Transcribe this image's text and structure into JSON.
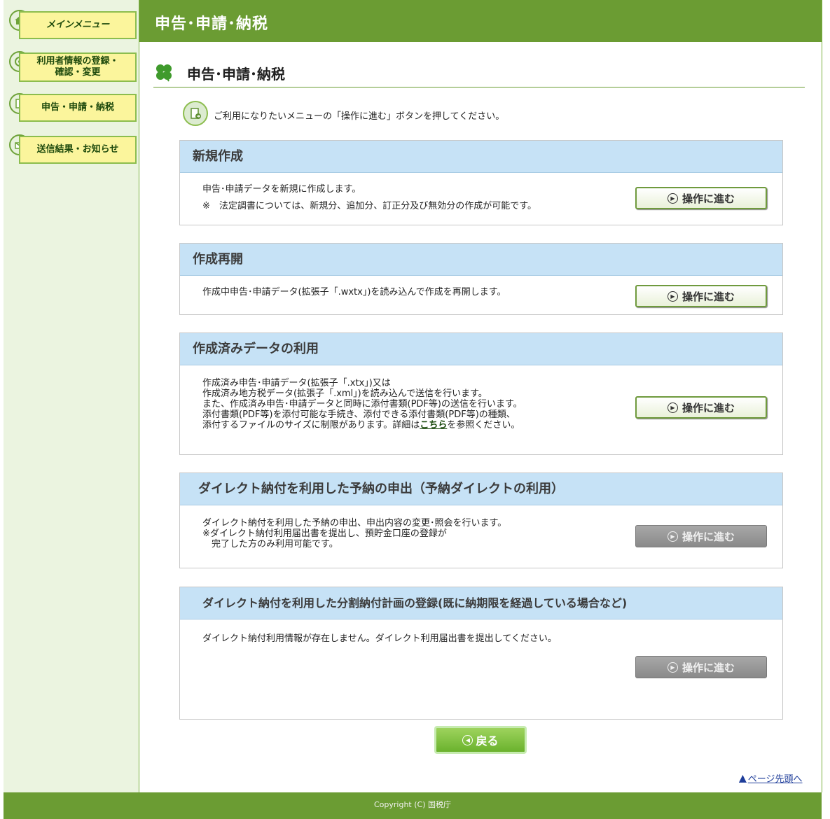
{
  "sidebar": {
    "items": [
      {
        "label": "メインメニュー",
        "icon": "home-icon"
      },
      {
        "label": "利用者情報の登録・\n確認・変更",
        "icon": "user-info-icon"
      },
      {
        "label": "申告・申請・納税",
        "icon": "document-icon"
      },
      {
        "label": "送信結果・お知らせ",
        "icon": "notice-icon"
      }
    ]
  },
  "header": {
    "title": "申告･申請･納税"
  },
  "page": {
    "heading": "申告･申請･納税",
    "instruction": "ご利用になりたいメニューの「操作に進む」ボタンを押してください。"
  },
  "sections": [
    {
      "title": "新規作成",
      "text": "申告･申請データを新規に作成します。",
      "note": "※　法定調書については、新規分、追加分、訂正分及び無効分の作成が可能です。",
      "button": "操作に進む",
      "enabled": true
    },
    {
      "title": "作成再開",
      "text": "作成中申告･申請データ(拡張子「.wxtx」)を読み込んで作成を再開します。",
      "button": "操作に進む",
      "enabled": true
    },
    {
      "title": "作成済みデータの利用",
      "text_lines": [
        "作成済み申告･申請データ(拡張子「.xtx」)又は",
        "作成済み地方税データ(拡張子「.xml」)を読み込んで送信を行います。",
        "また、作成済み申告･申請データと同時に添付書類(PDF等)の送信を行います。",
        "添付書類(PDF等)を添付可能な手続き、添付できる添付書類(PDF等)の種類、"
      ],
      "text_last_before": "添付するファイルのサイズに制限があります。詳細は",
      "link": "こちら",
      "text_last_after": "を参照ください。",
      "button": "操作に進む",
      "enabled": true
    },
    {
      "title": "ダイレクト納付を利用した予納の申出（予納ダイレクトの利用）",
      "text": "ダイレクト納付を利用した予納の申出、申出内容の変更･照会を行います。\n※ダイレクト納付利用届出書を提出し、預貯金口座の登録が\n　完了した方のみ利用可能です。",
      "button": "操作に進む",
      "enabled": false
    },
    {
      "title": "ダイレクト納付を利用した分割納付計画の登録(既に納期限を経過している場合など)",
      "text": "ダイレクト納付利用情報が存在しません。ダイレクト利用届出書を提出してください。",
      "button": "操作に進む",
      "enabled": false
    }
  ],
  "back_button": "戻る",
  "page_top": "ページ先頭へ",
  "footer": "Copyright (C) 国税庁",
  "colors": {
    "header_green": "#6b9c33",
    "section_blue": "#c6e2f6",
    "nav_yellow": "#fbf59c"
  }
}
